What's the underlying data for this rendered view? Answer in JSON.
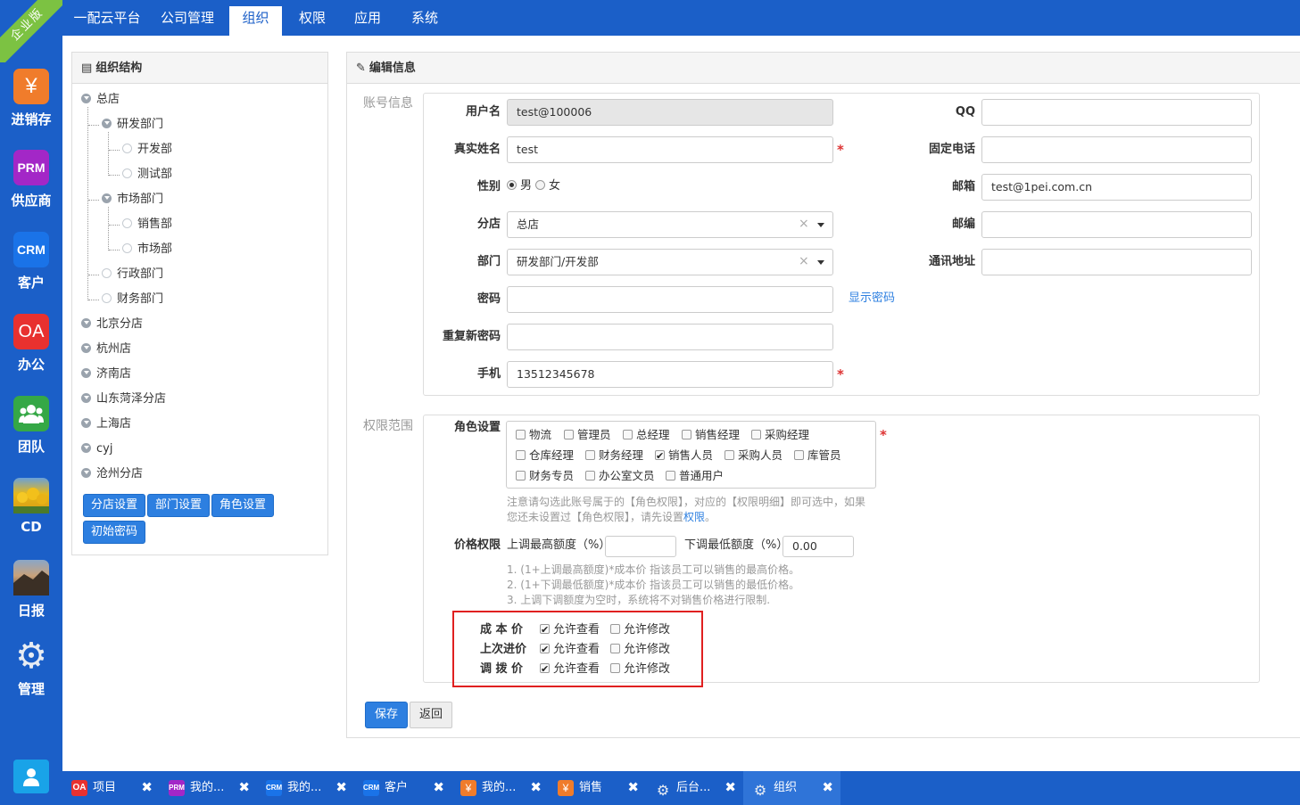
{
  "corner_badge": "企业版",
  "apps": [
    {
      "icon": "yen-icon",
      "glyph": "¥",
      "color": "#f07c2b",
      "label": "进销存"
    },
    {
      "icon": "prm-icon",
      "glyph": "PRM",
      "color": "#a327c7",
      "label": "供应商"
    },
    {
      "icon": "crm-icon",
      "glyph": "CRM",
      "color": "#1a73e8",
      "label": "客户"
    },
    {
      "icon": "oa-icon",
      "glyph": "OA",
      "color": "#e8312f",
      "label": "办公"
    },
    {
      "icon": "team-icon",
      "glyph": "",
      "color": "#35a846",
      "label": "团队"
    },
    {
      "icon": "cd-photo-icon",
      "glyph": "",
      "color": "#d8a21a",
      "label": "CD"
    },
    {
      "icon": "daily-photo-icon",
      "glyph": "",
      "color": "#6b5a4a",
      "label": "日报"
    },
    {
      "icon": "gear-icon",
      "glyph": "⚙",
      "color": "transparent",
      "label": "管理"
    }
  ],
  "user_icon": "user-icon",
  "topnav": {
    "brand": "一配云平台",
    "items": [
      "公司管理",
      "组织",
      "权限",
      "应用",
      "系统"
    ],
    "active": "组织"
  },
  "org_panel": {
    "title": "组织结构",
    "tree": [
      {
        "label": "总店",
        "type": "open"
      },
      {
        "label": "研发部门",
        "type": "open"
      },
      {
        "label": "开发部",
        "type": "leaf"
      },
      {
        "label": "测试部",
        "type": "leaf"
      },
      {
        "label": "市场部门",
        "type": "open"
      },
      {
        "label": "销售部",
        "type": "leaf"
      },
      {
        "label": "市场部",
        "type": "leaf"
      },
      {
        "label": "行政部门",
        "type": "leaf"
      },
      {
        "label": "财务部门",
        "type": "leaf"
      },
      {
        "label": "北京分店",
        "type": "open"
      },
      {
        "label": "杭州店",
        "type": "open"
      },
      {
        "label": "济南店",
        "type": "open"
      },
      {
        "label": "山东菏泽分店",
        "type": "open"
      },
      {
        "label": "上海店",
        "type": "open"
      },
      {
        "label": "cyj",
        "type": "open"
      },
      {
        "label": "沧州分店",
        "type": "open"
      }
    ],
    "buttons": [
      "分店设置",
      "部门设置",
      "角色设置",
      "初始密码"
    ]
  },
  "edit_panel": {
    "title": "编辑信息",
    "account_section": "账号信息",
    "labels": {
      "username": "用户名",
      "realname": "真实姓名",
      "gender": "性别",
      "branch": "分店",
      "dept": "部门",
      "password": "密码",
      "repeat_password": "重复新密码",
      "mobile": "手机",
      "qq": "QQ",
      "phone": "固定电话",
      "email": "邮箱",
      "zip": "邮编",
      "address": "通讯地址"
    },
    "values": {
      "username": "test@100006",
      "realname": "test",
      "branch": "总店",
      "dept": "研发部门/开发部",
      "password": "",
      "repeat_password": "",
      "mobile": "13512345678",
      "qq": "",
      "phone": "",
      "email": "test@1pei.com.cn",
      "zip": "",
      "address": ""
    },
    "gender_options": [
      "男",
      "女"
    ],
    "gender_selected": "男",
    "show_password": "显示密码",
    "required_mark": "*",
    "clear_mark": "×",
    "perm_section": "权限范围",
    "role_label": "角色设置",
    "roles": [
      {
        "label": "物流",
        "checked": false
      },
      {
        "label": "管理员",
        "checked": false
      },
      {
        "label": "总经理",
        "checked": false
      },
      {
        "label": "销售经理",
        "checked": false
      },
      {
        "label": "采购经理",
        "checked": false
      },
      {
        "label": "仓库经理",
        "checked": false
      },
      {
        "label": "财务经理",
        "checked": false
      },
      {
        "label": "销售人员",
        "checked": true
      },
      {
        "label": "采购人员",
        "checked": false
      },
      {
        "label": "库管员",
        "checked": false
      },
      {
        "label": "财务专员",
        "checked": false
      },
      {
        "label": "办公室文员",
        "checked": false
      },
      {
        "label": "普通用户",
        "checked": false
      }
    ],
    "role_note_line1": "注意请勾选此账号属于的【角色权限】，对应的【权限明细】即可选中，如果",
    "role_note_line2_pre": "您还未设置过【角色权限】，请先设置",
    "role_note_link": "权限",
    "role_note_line2_post": "。",
    "price_label": "价格权限",
    "price_up_label": "上调最高额度（%）",
    "price_up_value": "",
    "price_down_label": "下调最低额度（%）",
    "price_down_value": "0.00",
    "price_notes": [
      "1. (1+上调最高额度)*成本价 指该员工可以销售的最高价格。",
      "2. (1+下调最低额度)*成本价 指该员工可以销售的最低价格。",
      "3. 上调下调额度为空时，系统将不对销售价格进行限制."
    ],
    "cost_rows": [
      {
        "label": "成 本 价",
        "view": true,
        "edit": false
      },
      {
        "label": "上次进价",
        "view": true,
        "edit": false
      },
      {
        "label": "调 拨 价",
        "view": true,
        "edit": false
      }
    ],
    "allow_view": "允许查看",
    "allow_edit": "允许修改",
    "highlight_color": "#e02020",
    "save": "保存",
    "back": "返回"
  },
  "taskbar": [
    {
      "icon": "oa-icon",
      "badge": "OA",
      "color": "#e8312f",
      "label": "项目"
    },
    {
      "icon": "prm-icon",
      "badge": "PRM",
      "color": "#a327c7",
      "label": "我的..."
    },
    {
      "icon": "crm-icon",
      "badge": "CRM",
      "color": "#1a73e8",
      "label": "我的..."
    },
    {
      "icon": "crm-icon",
      "badge": "CRM",
      "color": "#1a73e8",
      "label": "客户"
    },
    {
      "icon": "yen-icon",
      "badge": "¥",
      "color": "#f07c2b",
      "label": "我的..."
    },
    {
      "icon": "yen-icon",
      "badge": "¥",
      "color": "#f07c2b",
      "label": "销售"
    },
    {
      "icon": "gear-icon",
      "badge": "⚙",
      "color": "transparent",
      "label": "后台..."
    },
    {
      "icon": "gear-icon",
      "badge": "⚙",
      "color": "transparent",
      "label": "组织"
    }
  ],
  "task_close": "✖",
  "task_active_index": 7
}
